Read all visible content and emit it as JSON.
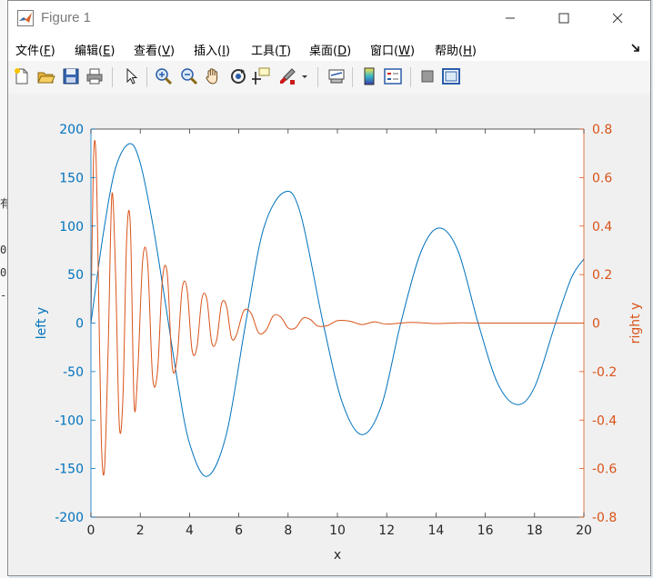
{
  "window": {
    "title": "Figure 1"
  },
  "menu": [
    {
      "label": "文件",
      "key": "F"
    },
    {
      "label": "编辑",
      "key": "E"
    },
    {
      "label": "查看",
      "key": "V"
    },
    {
      "label": "插入",
      "key": "I"
    },
    {
      "label": "工具",
      "key": "T"
    },
    {
      "label": "桌面",
      "key": "D"
    },
    {
      "label": "窗口",
      "key": "W"
    },
    {
      "label": "帮助",
      "key": "H"
    }
  ],
  "toolbar": {
    "icons": [
      "new-figure-icon",
      "open-file-icon",
      "save-icon",
      "print-icon",
      "pointer-icon",
      "zoom-in-icon",
      "zoom-out-icon",
      "pan-icon",
      "rotate-3d-icon",
      "data-cursor-icon",
      "brush-icon",
      "brush-dropdown-icon",
      "link-plot-icon",
      "colorbar-icon",
      "legend-icon",
      "hide-plot-tools-icon",
      "show-plot-tools-icon"
    ]
  },
  "colors": {
    "left_series": "#0072BD",
    "right_series": "#D95319",
    "axes": "#262626",
    "plot_bg": "#ffffff"
  },
  "chart_data": {
    "type": "line",
    "title": "",
    "xlabel": "x",
    "ylabel_left": "left y",
    "ylabel_right": "right y",
    "xlim": [
      0,
      20
    ],
    "ylim_left": [
      -200,
      200
    ],
    "ylim_right": [
      -0.8,
      0.8
    ],
    "xticks": [
      "0",
      "2",
      "4",
      "6",
      "8",
      "10",
      "12",
      "14",
      "16",
      "18",
      "20"
    ],
    "yticks_left": [
      "-200",
      "-150",
      "-100",
      "-50",
      "0",
      "50",
      "100",
      "150",
      "200"
    ],
    "yticks_right": [
      "-0.8",
      "-0.6",
      "-0.4",
      "-0.2",
      "0",
      "0.2",
      "0.4",
      "0.6",
      "0.8"
    ],
    "grid": false,
    "series": [
      {
        "axis": "left",
        "x": [
          0,
          0.5,
          1.0,
          1.57,
          2.0,
          2.5,
          3.0,
          3.5,
          4.0,
          4.71,
          5.5,
          6.28,
          7.0,
          7.85,
          8.5,
          9.42,
          10.2,
          11.0,
          11.8,
          12.57,
          13.4,
          14.14,
          14.9,
          15.71,
          16.5,
          17.28,
          18.0,
          18.85,
          19.5,
          20.0
        ],
        "y": [
          0,
          92,
          160,
          185,
          165,
          103,
          24,
          -58,
          -124,
          -158,
          -114,
          0,
          97,
          135,
          113,
          0,
          -82,
          -115,
          -84,
          0,
          74,
          98,
          74,
          0,
          -62,
          -84,
          -66,
          0,
          47,
          66
        ]
      },
      {
        "axis": "right",
        "x": [
          0,
          0.1,
          0.2,
          0.3,
          0.42,
          0.55,
          0.7,
          0.85,
          1.0,
          1.15,
          1.3,
          1.45,
          1.6,
          1.75,
          1.9,
          2.1,
          2.3,
          2.5,
          2.7,
          2.9,
          3.1,
          3.3,
          3.5,
          3.7,
          3.9,
          4.1,
          4.3,
          4.5,
          4.7,
          4.9,
          5.1,
          5.3,
          5.5,
          5.7,
          5.9,
          6.2,
          6.5,
          6.8,
          7.1,
          7.4,
          7.7,
          8.0,
          8.3,
          8.6,
          8.9,
          9.2,
          9.6,
          10.0,
          10.5,
          11.0,
          11.5,
          12.0,
          13.0,
          14.0,
          15.0,
          16.0,
          17.0,
          18.0,
          19.0,
          20.0
        ],
        "y": [
          0,
          0.66,
          0.7,
          0.2,
          -0.48,
          -0.6,
          -0.1,
          0.53,
          0.2,
          -0.42,
          -0.3,
          0.35,
          0.4,
          -0.33,
          -0.2,
          0.26,
          0.25,
          -0.22,
          -0.2,
          0.18,
          0.2,
          -0.18,
          -0.14,
          0.14,
          0.14,
          -0.11,
          -0.1,
          0.1,
          0.1,
          -0.08,
          -0.07,
          0.08,
          0.07,
          -0.06,
          -0.05,
          0.05,
          0.04,
          -0.04,
          -0.03,
          0.03,
          0.025,
          -0.02,
          -0.02,
          0.02,
          0.015,
          -0.012,
          -0.01,
          0.01,
          0.008,
          -0.006,
          0.005,
          -0.004,
          0.003,
          -0.002,
          0.001,
          0,
          0,
          0,
          0,
          0
        ]
      }
    ]
  }
}
